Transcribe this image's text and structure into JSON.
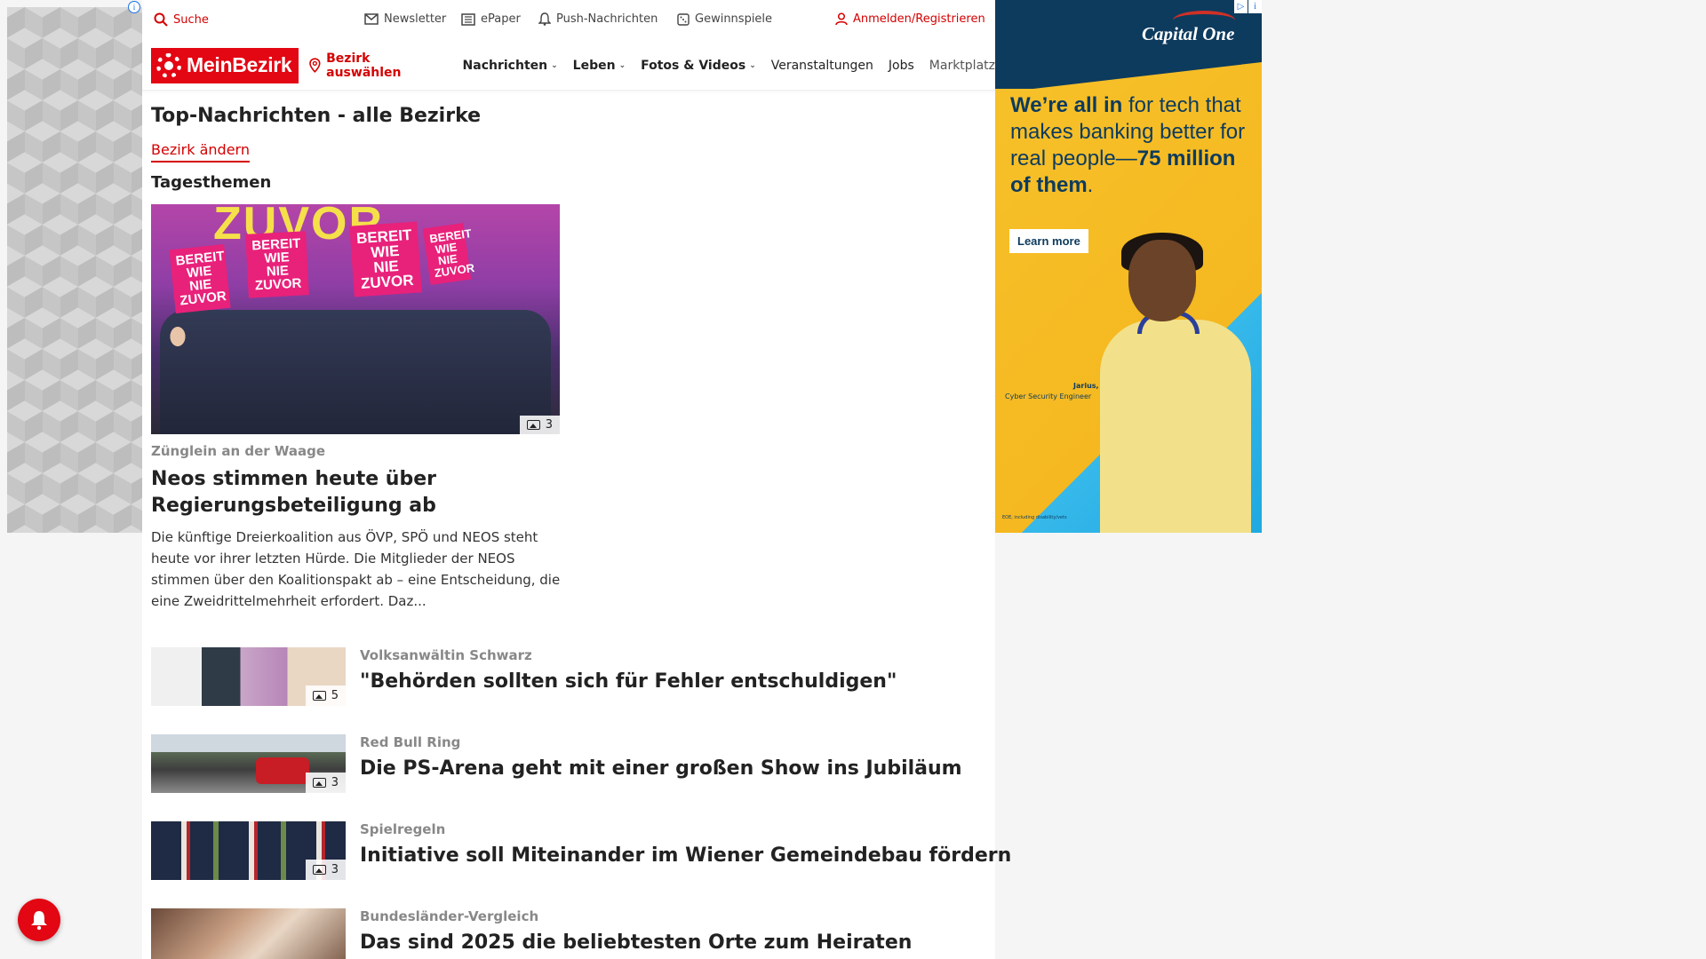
{
  "topbar": {
    "search": "Suche",
    "newsletter": "Newsletter",
    "epaper": "ePaper",
    "push": "Push-Nachrichten",
    "gewinnspiele": "Gewinnspiele",
    "login": "Anmelden/Registrieren"
  },
  "nav": {
    "logo": "MeinBezirk",
    "bezirk_select": "Bezirk auswählen",
    "items": [
      {
        "label": "Nachrichten",
        "dropdown": true
      },
      {
        "label": "Leben",
        "dropdown": true
      },
      {
        "label": "Fotos & Videos",
        "dropdown": true
      },
      {
        "label": "Veranstaltungen",
        "dropdown": false
      },
      {
        "label": "Jobs",
        "dropdown": false
      },
      {
        "label": "Marktplatz",
        "dropdown": false
      }
    ]
  },
  "page": {
    "title": "Top-Nachrichten - alle Bezirke",
    "change_link": "Bezirk ändern",
    "section_title": "Tagesthemen"
  },
  "lead": {
    "image_count": "3",
    "image_text_zuvor": "ZUVOR",
    "sign_text": "BEREIT WIE NIE ZUVOR",
    "kicker": "Zünglein an der Waage",
    "title": "Neos stimmen heute über Regierungsbeteiligung ab",
    "teaser": "Die künftige Dreierkoalition aus ÖVP, SPÖ und NEOS steht heute vor ihrer letzten Hürde. Die Mitglieder der NEOS stimmen über den Koalitionspakt ab – eine Entscheidung, die eine Zweidrittelmehrheit erfordert. Daz..."
  },
  "articles": [
    {
      "kicker": "Volksanwältin Schwarz",
      "title": "\"Behörden sollten sich für Fehler entschuldigen\"",
      "image_count": "5"
    },
    {
      "kicker": "Red Bull Ring",
      "title": "Die PS-Arena geht mit einer großen Show ins Jubiläum",
      "image_count": "3"
    },
    {
      "kicker": "Spielregeln",
      "title": "Initiative soll Miteinander im Wiener Gemeindebau fördern",
      "image_count": "3"
    },
    {
      "kicker": "Bundesländer-Vergleich",
      "title": "Das sind 2025 die beliebtesten Orte zum Heiraten",
      "image_count": ""
    }
  ],
  "ad": {
    "brand": "Capital One",
    "headline_bold_1": "We’re all in",
    "headline_rest": " for tech that makes banking better for real people—",
    "headline_bold_2": "75 million of them",
    "headline_end": ".",
    "cta": "Learn more",
    "caption_name": "Jarius,",
    "caption_role": "Cyber Security Engineer",
    "fine_print": "EOE, including disability/vets"
  },
  "colors": {
    "brand_red": "#e30613",
    "link_red": "#d40000",
    "ad_navy": "#0d3b5e",
    "ad_yellow": "#f7c22b",
    "ad_blue": "#1fa9e0"
  }
}
